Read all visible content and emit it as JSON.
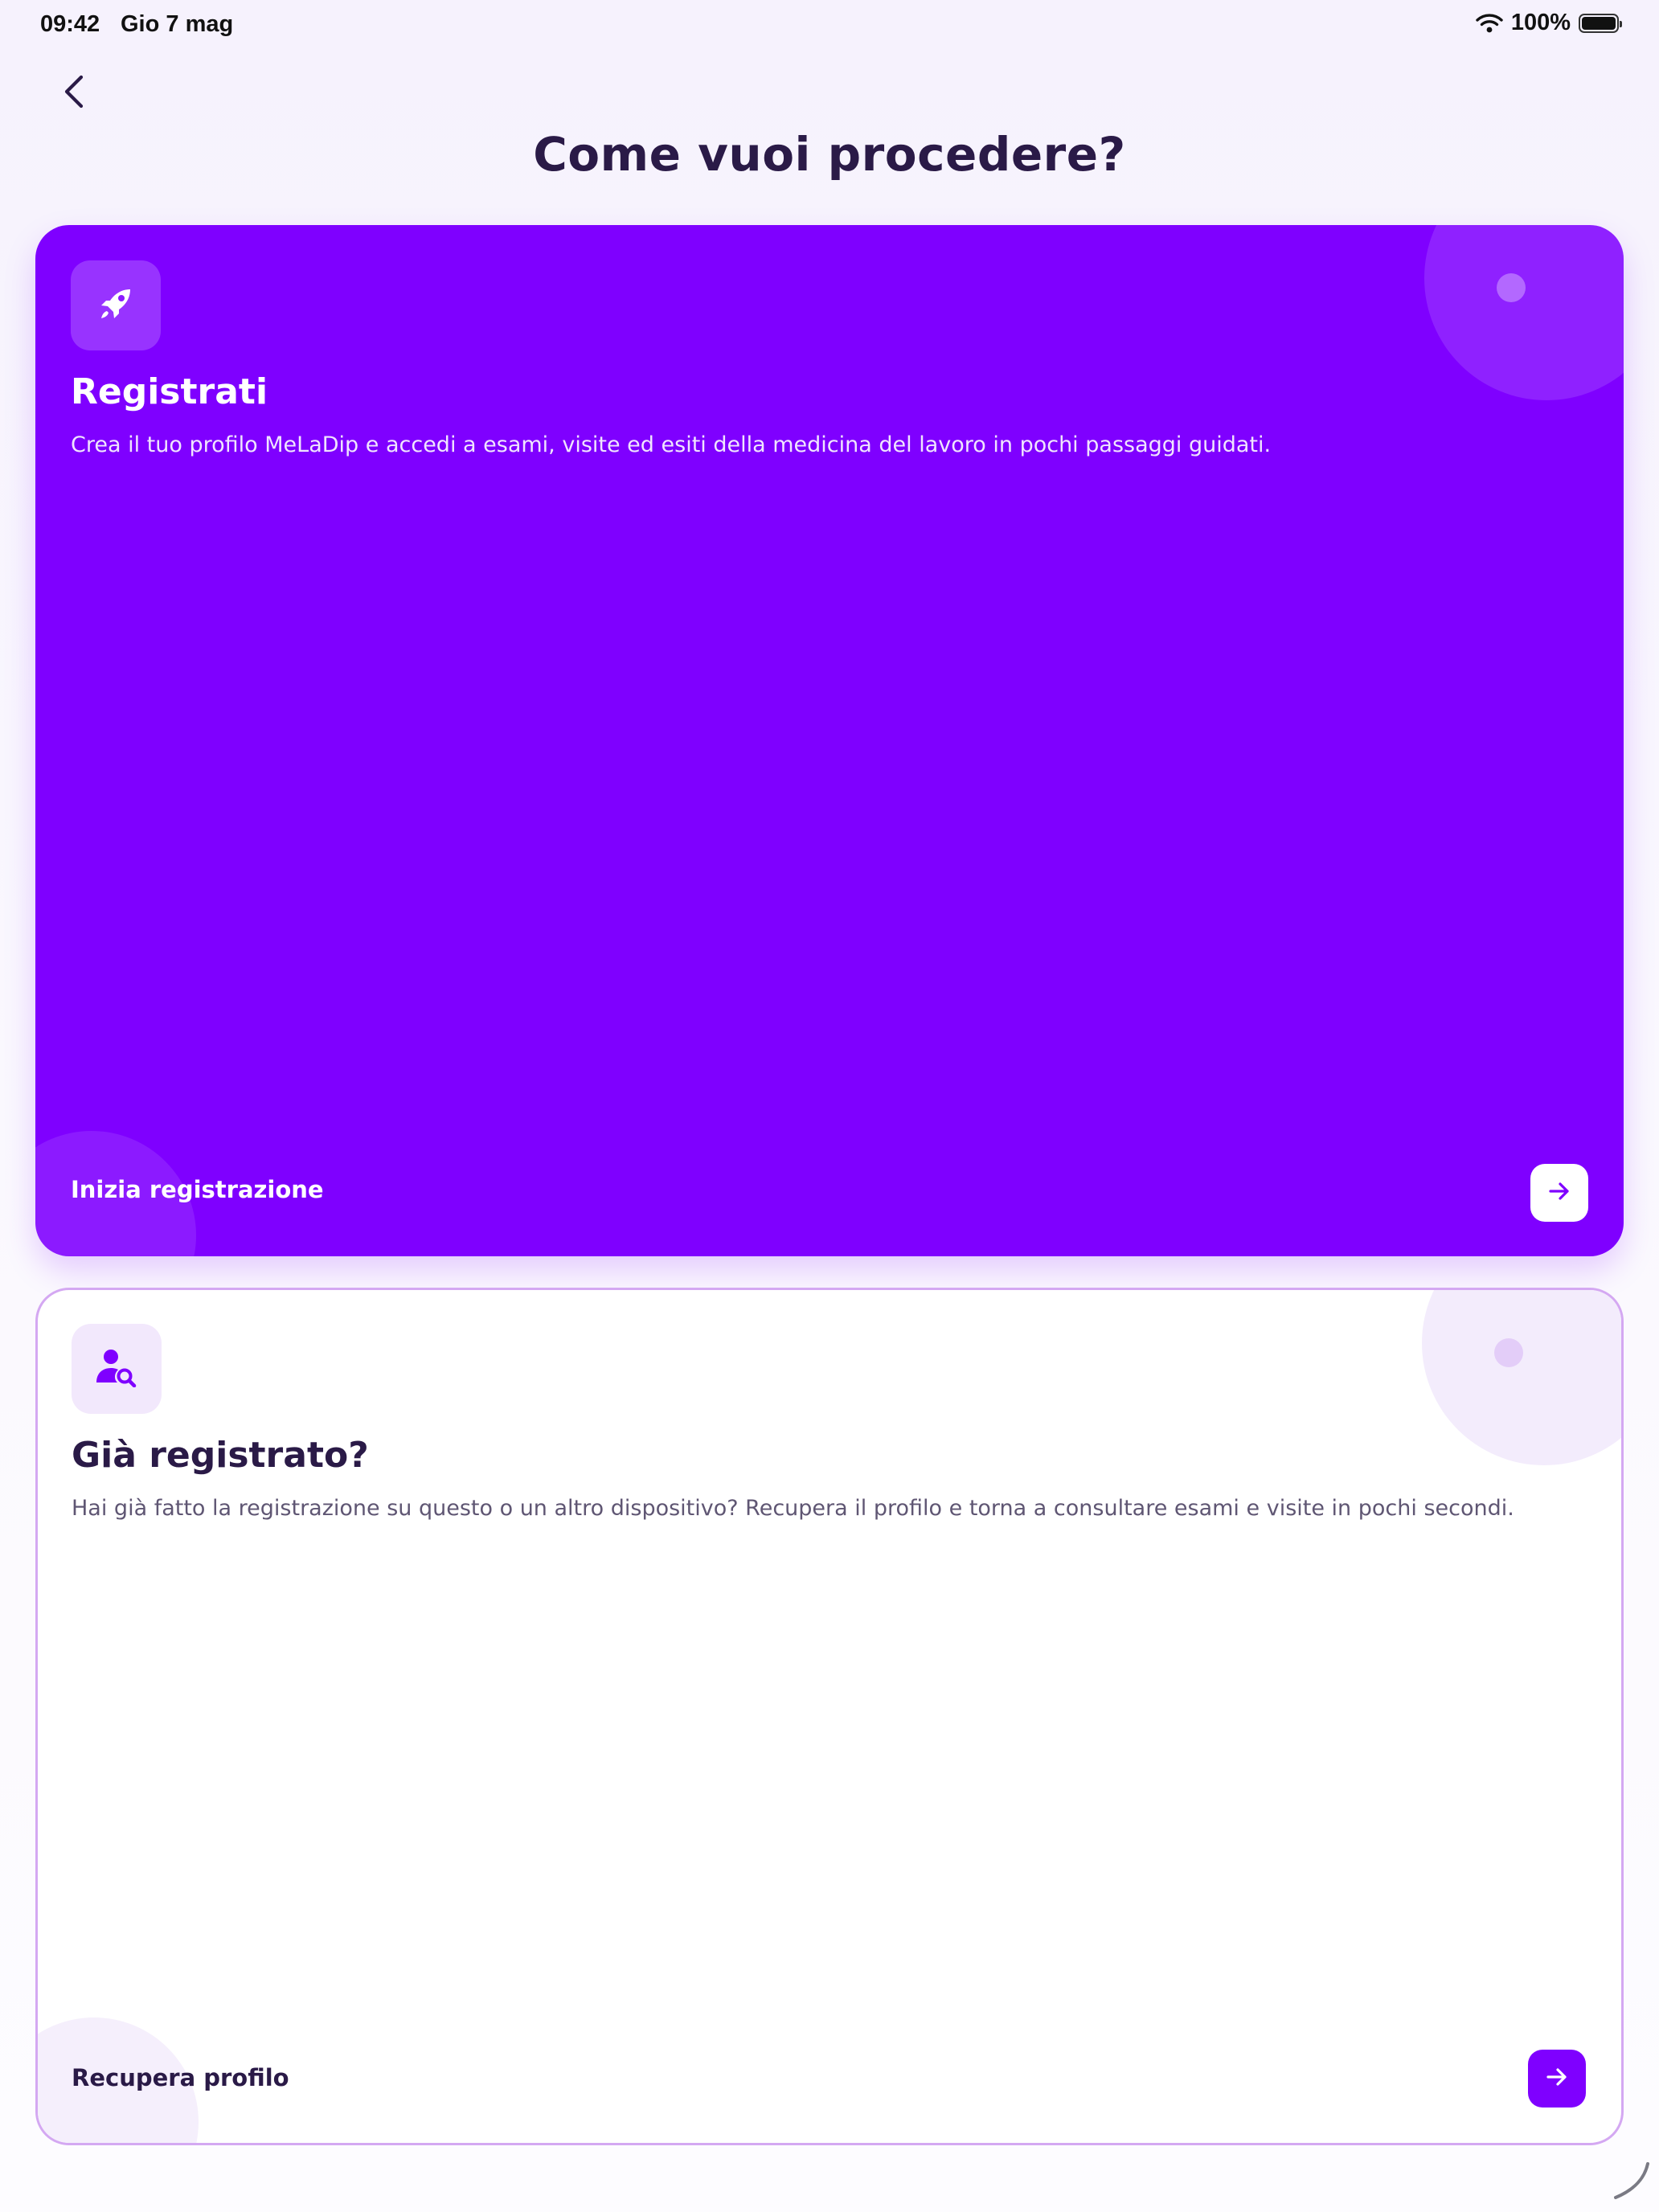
{
  "status_bar": {
    "time": "09:42",
    "date": "Gio 7 mag",
    "battery": "100%"
  },
  "header": {
    "title": "Come vuoi procedere?"
  },
  "cards": [
    {
      "id": "register",
      "icon": "rocket-icon",
      "title": "Registrati",
      "description": "Crea il tuo profilo MeLaDip e accedi a esami, visite ed esiti della medicina del lavoro in pochi passaggi guidati.",
      "action_label": "Inizia registrazione"
    },
    {
      "id": "recover",
      "icon": "user-search-icon",
      "title": "Già registrato?",
      "description": "Hai già fatto la registrazione su questo o un altro dispositivo? Recupera il profilo e torna a consultare esami e visite in pochi secondi.",
      "action_label": "Recupera profilo"
    }
  ],
  "colors": {
    "accent": "#7f00ff",
    "title_text": "#2a1a47",
    "card_border": "#d4a8f2"
  }
}
